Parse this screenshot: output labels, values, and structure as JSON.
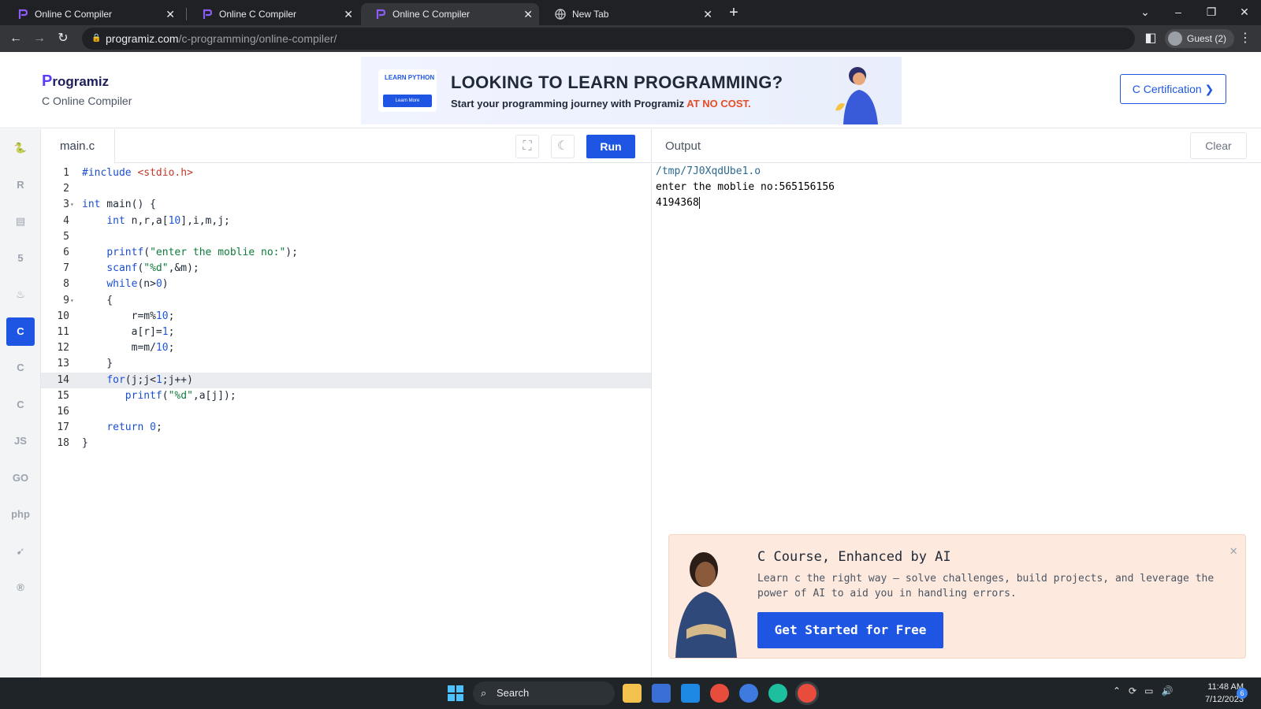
{
  "browser": {
    "tabs": [
      {
        "title": "Online C Compiler",
        "active": false
      },
      {
        "title": "Online C Compiler",
        "active": false
      },
      {
        "title": "Online C Compiler",
        "active": true
      },
      {
        "title": "New Tab",
        "active": false
      }
    ],
    "url_host": "programiz.com",
    "url_path": "/c-programming/online-compiler/",
    "profile": "Guest (2)"
  },
  "header": {
    "logo": "rogramiz",
    "logo_p": "P",
    "subtitle": "C Online Compiler",
    "cert_button": "C Certification ❯"
  },
  "banner": {
    "badge_title": "LEARN PYTHON",
    "badge_button": "Learn More",
    "headline": "LOOKING TO LEARN PROGRAMMING?",
    "subline": "Start your programming journey with Programiz",
    "subline_accent": "AT NO COST."
  },
  "sidebar": {
    "languages": [
      {
        "icon": "python-icon",
        "glyph": "🐍"
      },
      {
        "icon": "r-icon",
        "glyph": "R"
      },
      {
        "icon": "sql-icon",
        "glyph": "▤"
      },
      {
        "icon": "html-icon",
        "glyph": "5"
      },
      {
        "icon": "java-icon",
        "glyph": "♨"
      },
      {
        "icon": "c-icon",
        "glyph": "C",
        "active": true
      },
      {
        "icon": "cpp-icon",
        "glyph": "C"
      },
      {
        "icon": "csharp-icon",
        "glyph": "C"
      },
      {
        "icon": "js-icon",
        "glyph": "JS"
      },
      {
        "icon": "go-icon",
        "glyph": "GO"
      },
      {
        "icon": "php-icon",
        "glyph": "php"
      },
      {
        "icon": "swift-icon",
        "glyph": "➹"
      },
      {
        "icon": "rust-icon",
        "glyph": "®"
      }
    ]
  },
  "editor": {
    "file_tab": "main.c",
    "run_label": "Run",
    "highlighted_line": 14,
    "lines": [
      "#include <stdio.h>",
      "",
      "int main() {",
      "    int n,r,a[10],i,m,j;",
      "",
      "    printf(\"enter the moblie no:\");",
      "    scanf(\"%d\",&m);",
      "    while(n>0)",
      "    {",
      "        r=m%10;",
      "        a[r]=1;",
      "        m=m/10;",
      "    }",
      "    for(j;j<1;j++)",
      "       printf(\"%d\",a[j]);",
      "",
      "    return 0;",
      "}"
    ]
  },
  "output": {
    "title": "Output",
    "clear_label": "Clear",
    "path_line": "/tmp/7J0XqdUbe1.o",
    "lines": [
      "enter the moblie no:565156156",
      "4194368"
    ]
  },
  "promo": {
    "title": "C Course, Enhanced by AI",
    "description": "Learn c the right way – solve challenges, build projects, and leverage the power of AI to aid you in handling errors.",
    "cta": "Get Started for Free"
  },
  "taskbar": {
    "search_label": "Search",
    "time": "11:48 AM",
    "date": "7/12/2023",
    "notification_count": "6"
  },
  "colors": {
    "accent": "#1e56e3",
    "promo_bg": "#fde9de",
    "chrome_dark": "#202124"
  }
}
